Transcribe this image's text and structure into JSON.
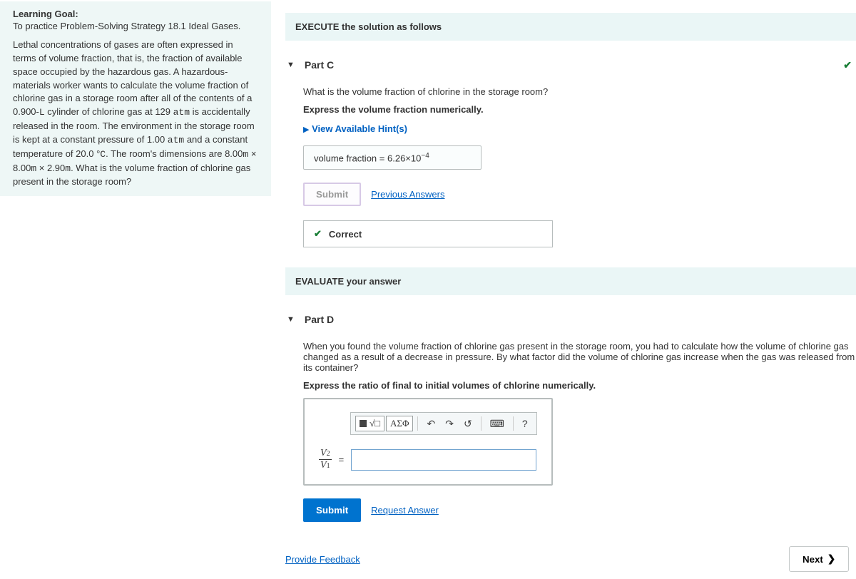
{
  "left": {
    "goal_title": "Learning Goal:",
    "goal_sub": "To practice Problem-Solving Strategy 18.1 Ideal Gases.",
    "body_html": "Lethal concentrations of gases are often expressed in terms of volume fraction, that is, the fraction of available space occupied by the hazardous gas. A hazardous-materials worker wants to calculate the volume fraction of chlorine gas in a storage room after all of the contents of a 0.900-L cylinder of chlorine gas at 129 atm  is accidentally released in the room. The environment in the storage room is kept at a constant pressure of 1.00 atm and a constant temperature of 20.0 °C. The room's dimensions are 8.00m × 8.00m × 2.90m. What is the volume fraction of chlorine gas present in the storage room?"
  },
  "execute_header": "EXECUTE the solution as follows",
  "partC": {
    "label": "Part C",
    "question": "What is the volume fraction of chlorine in the storage room?",
    "instruction": "Express the volume fraction numerically.",
    "hints": "View Available Hint(s)",
    "ans_prefix": "volume fraction",
    "ans_value": "6.26×10",
    "ans_exp": "−4",
    "submit": "Submit",
    "prev_answers": "Previous Answers",
    "feedback": "Correct"
  },
  "evaluate_header": "EVALUATE your answer",
  "partD": {
    "label": "Part D",
    "question": "When you found the volume fraction of chlorine gas present in the storage room, you had to calculate how the volume of chlorine gas changed as a result of a decrease in pressure. By what factor did the volume of chlorine gas increase when the gas was released from its container?",
    "instruction": "Express the ratio of final to initial volumes of chlorine numerically.",
    "toolbar_greek": "ΑΣΦ",
    "lhs_num": "V",
    "lhs_num_sub": "2",
    "lhs_den": "V",
    "lhs_den_sub": "1",
    "submit": "Submit",
    "request": "Request Answer"
  },
  "footer": {
    "feedback": "Provide Feedback",
    "next": "Next"
  }
}
